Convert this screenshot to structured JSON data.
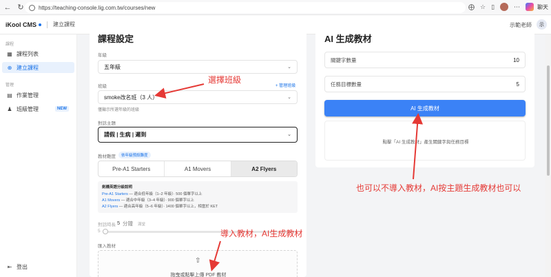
{
  "browser": {
    "url": "https://teaching-console.lig.com.tw/courses/new",
    "chat_label": "聊天"
  },
  "header": {
    "brand": "iKool CMS",
    "crumb": "建立課程",
    "user_name": "示範老師",
    "avatar_text": "示"
  },
  "sidebar": {
    "group_course": "課程",
    "items_course": [
      {
        "label": "課程列表",
        "icon": "grid-icon"
      },
      {
        "label": "建立課程",
        "icon": "plus-circle-icon"
      }
    ],
    "group_manage": "管理",
    "items_manage": [
      {
        "label": "作業管理",
        "icon": "document-icon"
      },
      {
        "label": "班級管理",
        "icon": "users-icon",
        "badge": "NEW"
      }
    ],
    "logout": "登出"
  },
  "form": {
    "title": "課程設定",
    "grade_label": "年級",
    "grade_value": "五年級",
    "class_label": "班級",
    "manage_class_link": "+ 管理班級",
    "class_value": "smoke改名班（3 人）",
    "class_hint": "僅顯示所選年級的班級",
    "topic_label": "對話主題",
    "topic_value": "請假 | 生病 | 遲到",
    "difficulty_label": "教材難度",
    "difficulty_tag": "依年級預設難度",
    "levels": [
      "Pre-A1 Starters",
      "A1 Movers",
      "A2 Flyers"
    ],
    "selected_level": "A2 Flyers",
    "info_title": "劍橋英語分級說明",
    "info_lines": [
      {
        "level": "Pre-A1 Starters",
        "desc": " — 適合低年級（1–2 年級）· 500 個單字以上"
      },
      {
        "level": "A1 Movers",
        "desc": " — 適合中年級（3–4 年級）· 900 個單字以上"
      },
      {
        "level": "A2 Flyers",
        "desc": " — 適合高年級（5–6 年級）· 1400 個單字以上，相當於 KET"
      }
    ],
    "duration_label": "對話時長",
    "duration_value": "5",
    "duration_unit": "分鐘",
    "duration_extra": "滿堂",
    "slider_min": "5",
    "import_label": "匯入教材",
    "upload_text": "拖曳或點擊上傳 PDF 教材"
  },
  "generator": {
    "title": "AI 生成教材",
    "keywords_label": "關鍵字數量",
    "keywords_value": "10",
    "tasks_label": "任務目標數量",
    "tasks_value": "5",
    "button": "AI 生成教材",
    "message": "點擊「AI 生成教材」產生關鍵字與任務目標"
  },
  "annotations": {
    "select_class": "選擇班級",
    "import_material": "導入教材，AI生成教材",
    "optional": "也可以不導入教材，AI按主題生成教材也可以",
    "color": "#e53935"
  }
}
